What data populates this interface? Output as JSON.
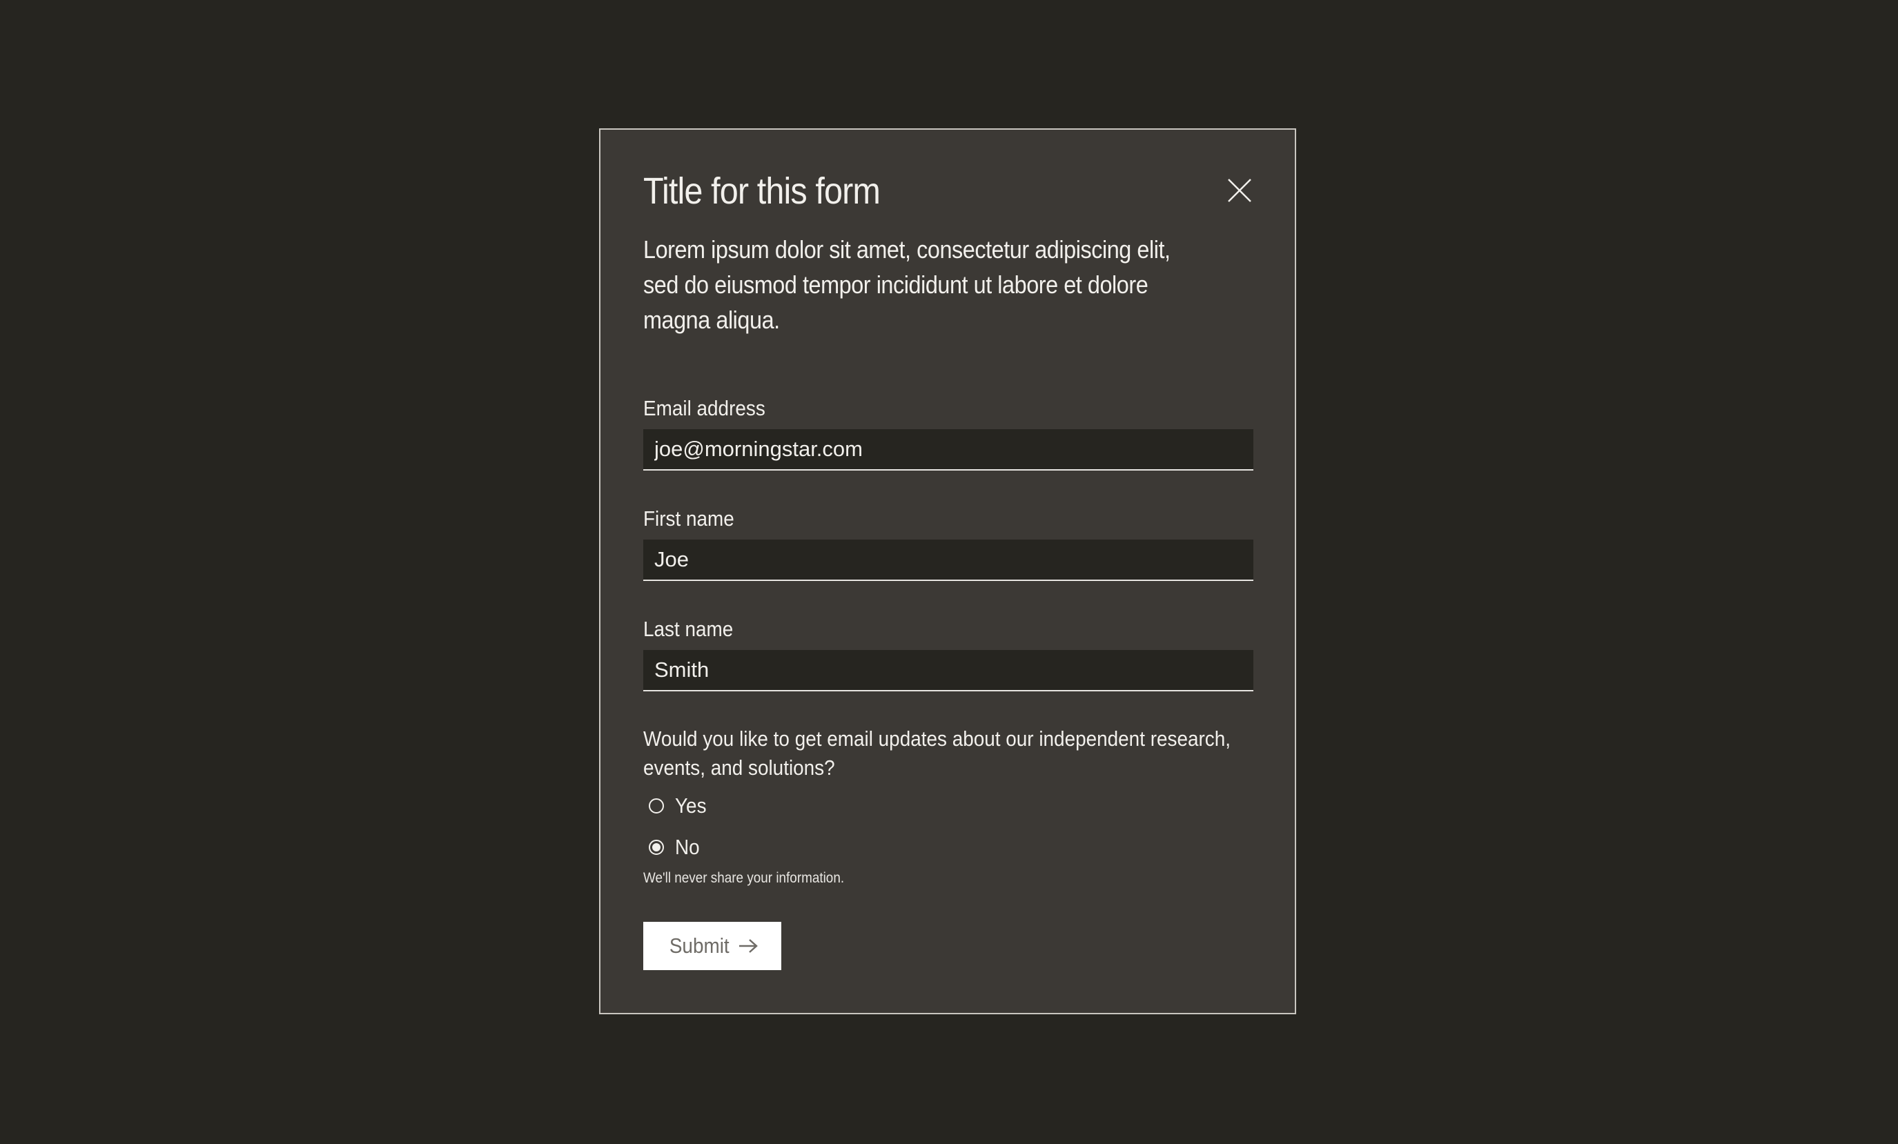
{
  "modal": {
    "title": "Title for this form",
    "description": "Lorem ipsum dolor sit amet, consectetur adipiscing elit, sed do eiusmod tempor incididunt ut labore et dolore magna aliqua.",
    "close_icon": "close-icon"
  },
  "form": {
    "email": {
      "label": "Email address",
      "value": "joe@morningstar.com"
    },
    "first_name": {
      "label": "First name",
      "value": "Joe"
    },
    "last_name": {
      "label": "Last name",
      "value": "Smith"
    },
    "question": "Would you like to get email updates about our independent research, events, and solutions?",
    "options": [
      {
        "label": "Yes",
        "checked": false
      },
      {
        "label": "No",
        "checked": true
      }
    ],
    "note": "We'll never share your information.",
    "submit_label": "Submit",
    "submit_icon": "arrow-right-icon"
  },
  "colors": {
    "page_background": "#262520",
    "modal_background": "#3c3935",
    "input_background": "#262520",
    "text": "#f2f0ec",
    "button_background": "#ffffff",
    "button_text": "#6e6b66"
  }
}
